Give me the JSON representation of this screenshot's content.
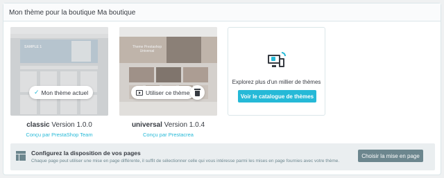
{
  "card": {
    "title": "Mon thème pour la boutique Ma boutique"
  },
  "themes": [
    {
      "name": "classic",
      "version_text": "Version 1.0.0",
      "author": "Conçu par PrestaShop Team",
      "current_label": "Mon thème actuel",
      "preview_banner": "SAMPLE 1"
    },
    {
      "name": "universal",
      "version_text": "Version 1.0.4",
      "author": "Conçu par Prestacrea",
      "use_label": "Utiliser ce thème",
      "preview_banner": "Theme Prestashop Universal"
    }
  ],
  "explore": {
    "text": "Explorez plus d'un millier de thèmes",
    "button": "Voir le catalogue de thèmes"
  },
  "layout": {
    "title": "Configurez la disposition de vos pages",
    "description": "Chaque page peut utiliser une mise en page différente, il suffit de sélectionner celle qui vous intéresse parmi les mises en page fournies avec votre thème.",
    "button": "Choisir la mise en page"
  },
  "colors": {
    "accent": "#25b9d7",
    "secondary": "#6c868e"
  }
}
